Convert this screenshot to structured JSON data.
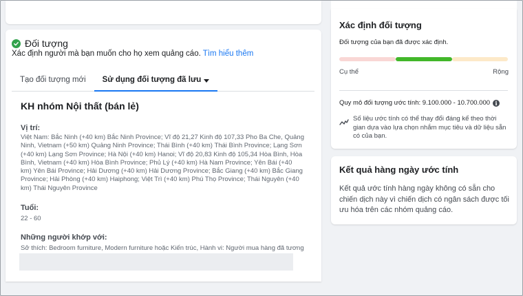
{
  "targeting": {
    "title": "Đối tượng",
    "description": "Xác định người mà bạn muốn cho họ xem quảng cáo. ",
    "learn_more": "Tìm hiểu thêm",
    "tabs": [
      {
        "label": "Tạo đối tượng mới"
      },
      {
        "label": "Sử dụng đối tượng đã lưu"
      }
    ],
    "audience_name": "KH nhóm Nội thất (bán lẻ)",
    "location_label": "Vị trí:",
    "location_value": "Việt Nam: Bắc Ninh (+40 km) Bắc Ninh Province; Vĩ độ 21,27 Kinh độ 107,33 Pho Ba Che, Quảng Ninh, Vietnam (+50 km) Quảng Ninh Province; Thái Bình (+40 km) Thái Bình Province; Lạng Sơn (+40 km) Lạng Sơn Province; Hà Nội (+40 km) Hanoi; Vĩ độ 20,83 Kinh độ 105,34 Hòa Bình, Hòa Bình, Vietnam (+40 km) Hòa Bình Province; Phủ Lý (+40 km) Hà Nam Province; Yên Bái (+40 km) Yên Bái Province; Hải Dương (+40 km) Hải Dương Province; Bắc Giang (+40 km) Bắc Giang Province; Hải Phòng (+40 km) Haiphong; Việt Trì (+40 km) Phú Thọ Province; Thái Nguyên (+40 km) Thái Nguyên Province",
    "age_label": "Tuổi:",
    "age_value": "22 - 60",
    "match_label": "Những người khớp với:",
    "match_value": "Sở thích: Bedroom furniture, Modern furniture hoặc Kiến trúc, Hành vi: Người mua hàng đã tương"
  },
  "definition": {
    "title": "Xác định đối tượng",
    "subtitle": "Đối tượng của bạn đã được xác định.",
    "left_label": "Cụ thể",
    "right_label": "Rộng",
    "meter_level": "middle",
    "size_text": "Quy mô đối tượng ước tính: 9.100.000 - 10.700.000",
    "info_glyph": "i",
    "note": "Số liệu ước tính có thể thay đổi đáng kể theo thời gian dựa vào lựa chọn nhắm mục tiêu và dữ liệu sẵn có của bạn."
  },
  "daily_results": {
    "title": "Kết quả hàng ngày ước tính",
    "text": "Kết quả ước tính hàng ngày không có sẵn cho chiến dịch này vì chiến dịch có ngân sách được tối ưu hóa trên các nhóm quảng cáo."
  },
  "colors": {
    "accent": "#1877f2",
    "success": "#31a24c",
    "meter_specific": "#f9d7d5",
    "meter_active": "#42b72a",
    "meter_broad": "#fde9c8"
  }
}
